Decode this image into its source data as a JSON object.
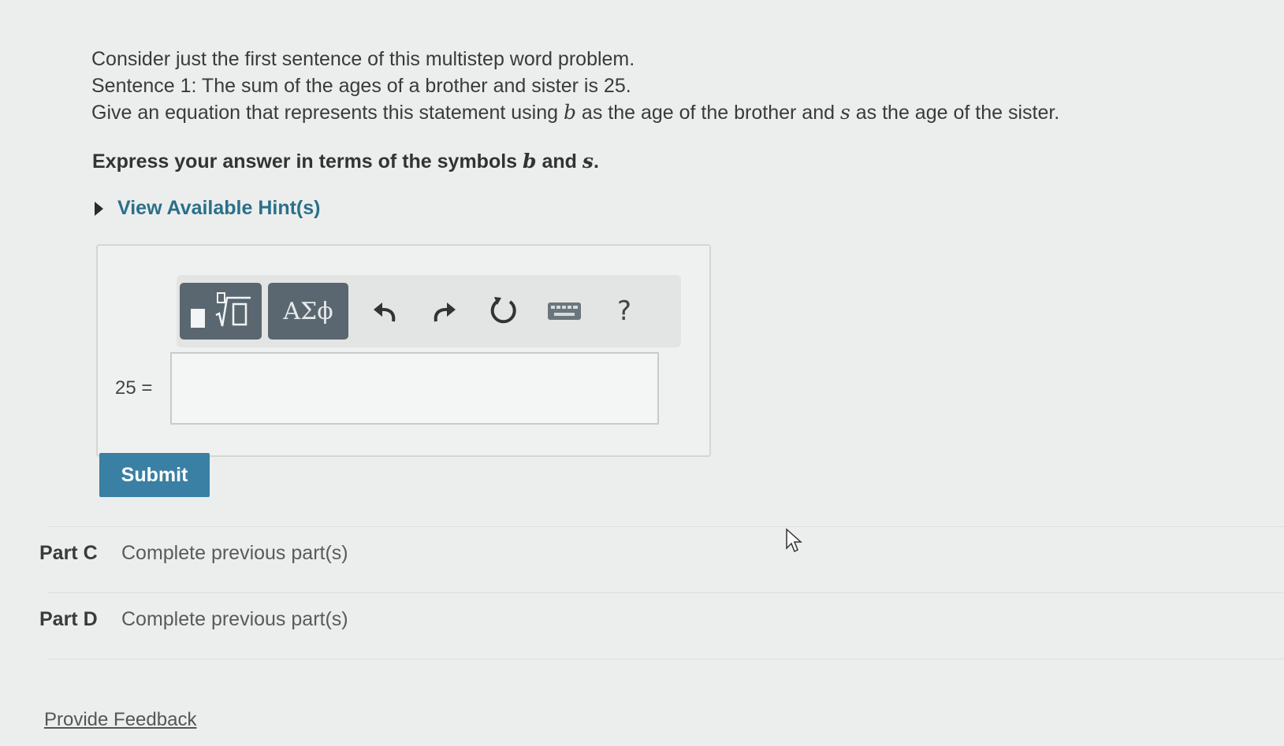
{
  "problem": {
    "intro": "Consider just the first sentence of this multistep word problem.",
    "sentence": "Sentence 1: The sum of the ages of a brother and sister is 25.",
    "task_part1": "Give an equation that represents this statement using ",
    "var_b": "b",
    "task_part2": " as the age of the brother and ",
    "var_s": "s",
    "task_part3": " as the age of the sister."
  },
  "instruction": {
    "text1": "Express your answer in terms of the symbols ",
    "var_b": "b",
    "and": " and ",
    "var_s": "s",
    "end": "."
  },
  "hint": {
    "label": "View Available Hint(s)",
    "icon": "caret-right-icon"
  },
  "toolbar": {
    "greek_label": "ΑΣϕ",
    "help_label": "?",
    "icons": [
      "templates-icon",
      "greek-letters-icon",
      "undo-icon",
      "redo-icon",
      "reset-icon",
      "keyboard-icon",
      "help-icon"
    ]
  },
  "equation": {
    "lhs": "25 =",
    "value": ""
  },
  "submit_label": "Submit",
  "parts": [
    {
      "name": "Part C",
      "status": "Complete previous part(s)"
    },
    {
      "name": "Part D",
      "status": "Complete previous part(s)"
    }
  ],
  "feedback_label": "Provide Feedback",
  "colors": {
    "accent": "#2b6f8a",
    "submit": "#3a7fa4",
    "toolbar_dark": "#5a6770",
    "background": "#eceeed"
  }
}
